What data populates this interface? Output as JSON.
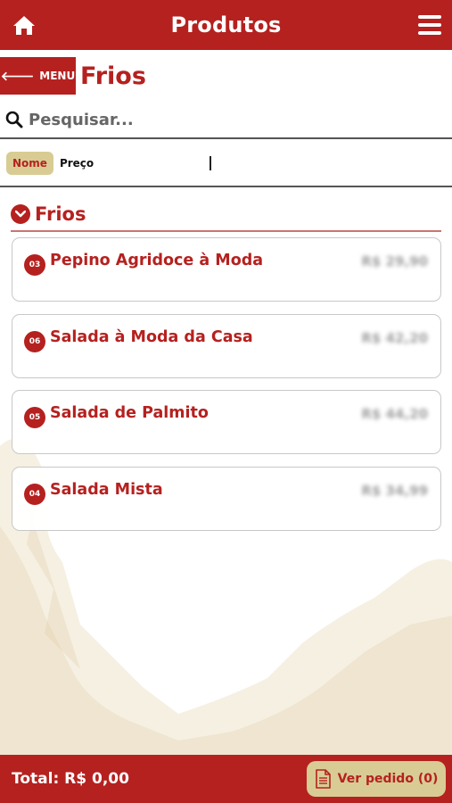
{
  "topbar": {
    "title": "Produtos",
    "home_icon": "home-icon",
    "menu_icon": "hamburger-icon"
  },
  "header": {
    "back_label": "MENU",
    "section_title": "Frios"
  },
  "search": {
    "placeholder": "Pesquisar..."
  },
  "sort": {
    "active": "Nome",
    "other": "Preço"
  },
  "group": {
    "label": "Frios"
  },
  "products": [
    {
      "code": "03",
      "name": "Pepino Agridoce à Moda",
      "price": "R$ 29,90"
    },
    {
      "code": "06",
      "name": "Salada à Moda da Casa",
      "price": "R$ 42,20"
    },
    {
      "code": "05",
      "name": "Salada de Palmito",
      "price": "R$ 44,20"
    },
    {
      "code": "04",
      "name": "Salada Mista",
      "price": "R$ 34,99"
    }
  ],
  "footer": {
    "total": "Total: R$ 0,00",
    "order_button": "Ver pedido (0)"
  },
  "colors": {
    "primary": "#b5211f",
    "accent": "#d8cc94"
  }
}
